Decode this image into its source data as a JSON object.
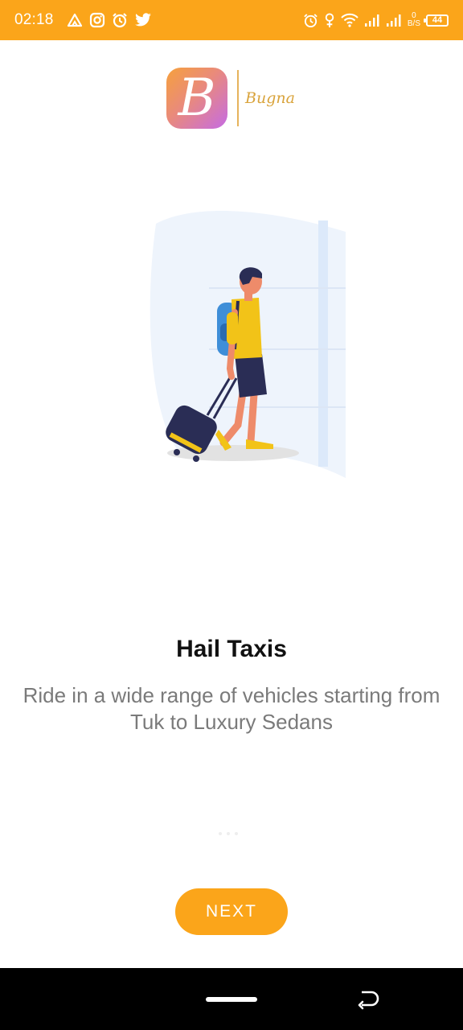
{
  "status_bar": {
    "time": "02:18",
    "left_icons": [
      "alert-triangle-icon",
      "instagram-icon",
      "alarm-icon",
      "twitter-icon"
    ],
    "right_icons": [
      "alarm-icon",
      "location-icon",
      "wifi-icon",
      "signal-icon",
      "signal-icon"
    ],
    "net_speed_value": "0",
    "net_speed_unit": "B/S",
    "battery": "44",
    "background": "#FBA51A"
  },
  "logo": {
    "letter": "B",
    "brand": "Bugna"
  },
  "onboarding": {
    "illustration": "traveler-with-luggage",
    "title": "Hail Taxis",
    "description": "Ride in a wide range of vehicles starting from Tuk to Luxury Sedans",
    "page_count": 3,
    "active_page": 0
  },
  "next_button": {
    "label": "NEXT",
    "color": "#FBA51A"
  },
  "nav_bar": {
    "icons": [
      "home-pill-icon",
      "back-icon"
    ]
  }
}
